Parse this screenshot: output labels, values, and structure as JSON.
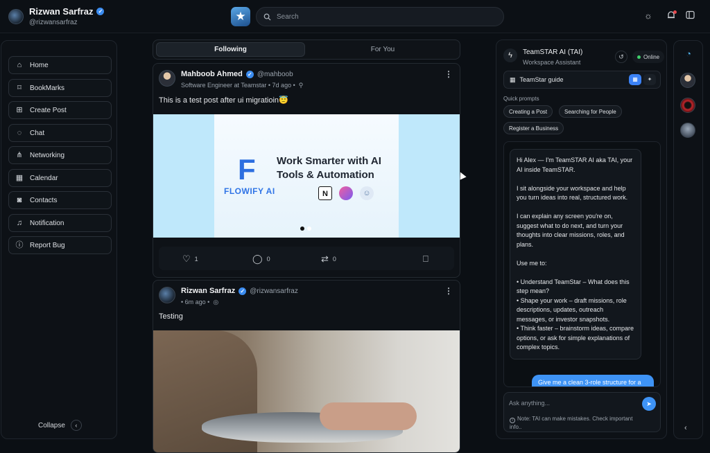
{
  "colors": {
    "accent": "#3e93f5",
    "bg": "#0b0f14",
    "online": "#3fcf6a"
  },
  "profile": {
    "name": "Rizwan Sarfraz",
    "handle": "@rizwansarfraz"
  },
  "search": {
    "placeholder": "Search"
  },
  "topbar_icons": [
    "sun-icon",
    "bell-icon",
    "panel-icon"
  ],
  "sidebar": {
    "items": [
      {
        "label": "Home",
        "icon": "home-icon"
      },
      {
        "label": "BookMarks",
        "icon": "bookmark-icon"
      },
      {
        "label": "Create Post",
        "icon": "plus-square-icon"
      },
      {
        "label": "Chat",
        "icon": "chat-icon"
      },
      {
        "label": "Networking",
        "icon": "network-icon"
      },
      {
        "label": "Calendar",
        "icon": "calendar-icon"
      },
      {
        "label": "Contacts",
        "icon": "contacts-icon"
      },
      {
        "label": "Notification",
        "icon": "bell-icon"
      },
      {
        "label": "Report Bug",
        "icon": "alert-icon"
      }
    ],
    "collapse_label": "Collapse"
  },
  "feed": {
    "tabs": [
      {
        "label": "Following"
      },
      {
        "label": "For You"
      }
    ],
    "posts": [
      {
        "author": "Mahboob Ahmed",
        "handle": "@mahboob",
        "subtitle": "Software Engineer at Teamstar • 7d ago •",
        "text": "This is a test post after ui migratioin😇",
        "image": {
          "headline": "Work Smarter with AI Tools & Automation",
          "brand": "FLOWIFY AI",
          "logo_mark": "F",
          "logo_n": "N"
        },
        "likes": "1",
        "comments": "0",
        "reposts": "0"
      },
      {
        "author": "Rizwan Sarfraz",
        "handle": "@rizwansarfraz",
        "subtitle": "• 6m ago •",
        "text": "Testing"
      }
    ]
  },
  "ai": {
    "title": "TeamSTAR AI (TAI)",
    "subtitle": "Workspace Assistant",
    "status": "Online",
    "guide_label": "TeamStar guide",
    "quick_prompts_label": "Quick prompts",
    "quick_prompts": [
      "Creating a Post",
      "Searching for People",
      "Register a Business"
    ],
    "message": "Hi Alex — I'm TeamSTAR AI aka TAI, your AI inside TeamSTAR.\n\nI sit alongside your workspace and help you turn ideas into real, structured work.\n\nI can explain any screen you're on, suggest what to do next, and turn your thoughts into clear missions, roles, and plans.\n\nUse me to:\n\n• Understand TeamStar – What does this step mean?\n• Shape your work – draft missions, role descriptions, updates, outreach messages, or investor snapshots.\n• Think faster – brainstorm ideas, compare options, or ask for simple explanations of complex topics.",
    "user_message": "Give me a clean 3-role structure for a",
    "input_placeholder": "Ask anything...",
    "note": "Note: TAI can make mistakes. Check important info.."
  }
}
